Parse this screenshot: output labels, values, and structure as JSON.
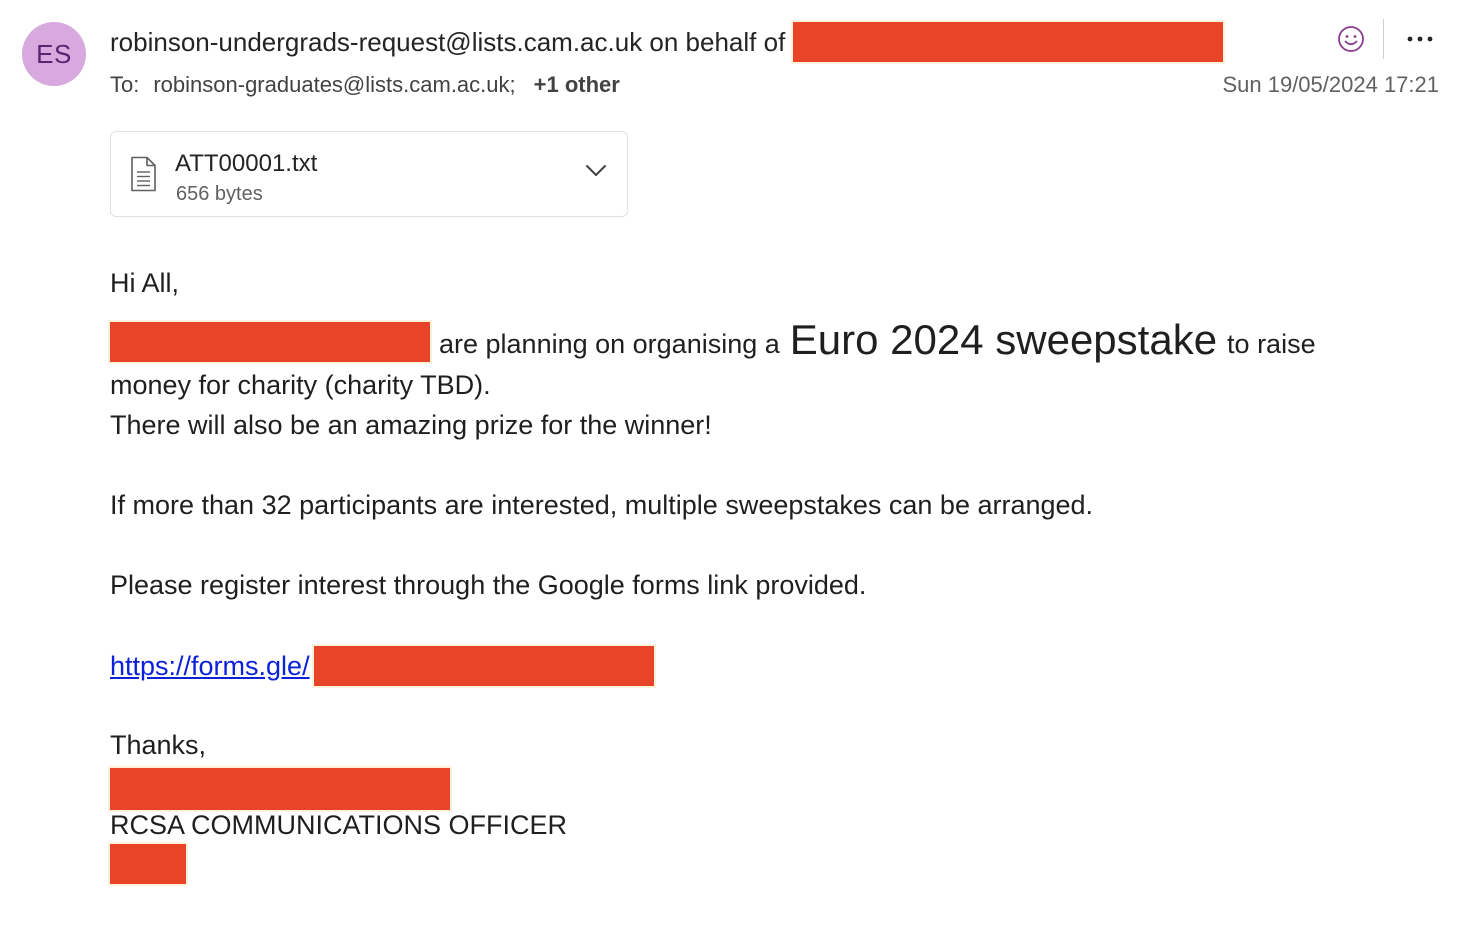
{
  "sender": {
    "initials": "ES",
    "from_text": "robinson-undergrads-request@lists.cam.ac.uk on behalf of",
    "to_label": "To:",
    "to_address": "robinson-graduates@lists.cam.ac.uk;",
    "others": "+1 other",
    "date": "Sun 19/05/2024 17:21"
  },
  "attachment": {
    "name": "ATT00001.txt",
    "size": "656 bytes"
  },
  "message": {
    "greeting": "Hi All,",
    "line1_part1": "are planning on organising a",
    "line1_emphasis": "Euro 2024 sweepstake",
    "line1_part2": "to raise",
    "line2": "money for charity (charity TBD).",
    "line3": "There will also be an amazing prize for the winner!",
    "line4": "If more than 32 participants are interested, multiple sweepstakes can be arranged.",
    "line5": "Please register interest through the Google forms link provided.",
    "link_text": "https://forms.gle/",
    "signoff": "Thanks,",
    "signature_title": "RCSA COMMUNICATIONS OFFICER"
  },
  "icons": {
    "avatar_color": "#d7a9de",
    "redaction_color": "#e84428",
    "link_color": "#0b22d8"
  }
}
